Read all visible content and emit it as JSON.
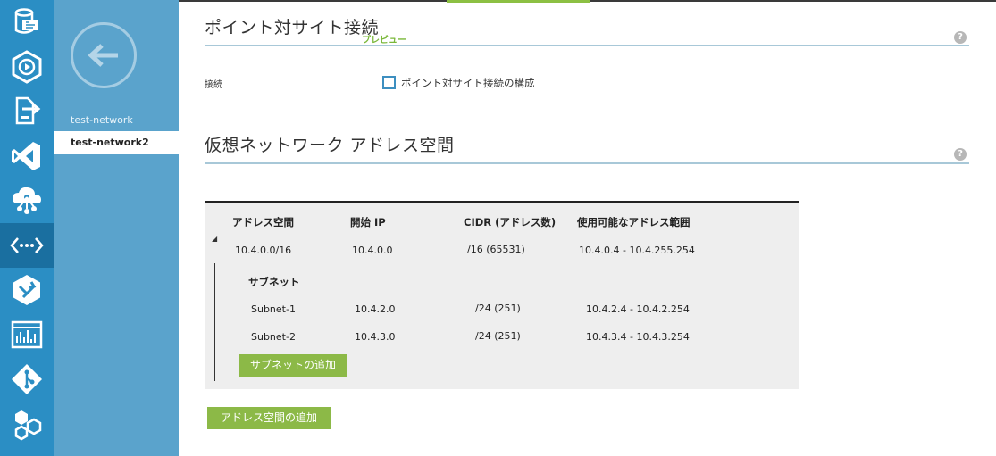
{
  "rail": {
    "icons": [
      "database-icon",
      "media-play-icon",
      "deploy-icon",
      "visual-studio-icon",
      "cloud-services-icon",
      "virtual-network-icon",
      "traffic-manager-icon",
      "dashboard-icon",
      "git-icon",
      "hexagon-apps-icon"
    ],
    "active_index": 5
  },
  "nav": {
    "back_icon": "arrow-left-icon",
    "items": [
      {
        "label": "test-network"
      },
      {
        "label": "test-network2"
      }
    ],
    "active_index": 1
  },
  "p2s": {
    "title": "ポイント対サイト接続",
    "preview": "プレビュー",
    "connection_label": "接続",
    "checkbox_label": "ポイント対サイト接続の構成",
    "checkbox_checked": false
  },
  "vnet": {
    "title": "仮想ネットワーク アドレス空間",
    "help": "?",
    "headers": {
      "space": "アドレス空間",
      "start_ip": "開始 IP",
      "cidr": "CIDR (アドレス数)",
      "range": "使用可能なアドレス範囲"
    },
    "address_space": {
      "space": "10.4.0.0/16",
      "start_ip": "10.4.0.0",
      "cidr": "/16 (65531)",
      "range": "10.4.0.4 - 10.4.255.254"
    },
    "subnet_header": "サブネット",
    "subnets": [
      {
        "name": "Subnet-1",
        "start_ip": "10.4.2.0",
        "cidr": "/24 (251)",
        "range": "10.4.2.4 - 10.4.2.254"
      },
      {
        "name": "Subnet-2",
        "start_ip": "10.4.3.0",
        "cidr": "/24 (251)",
        "range": "10.4.3.4 - 10.4.3.254"
      }
    ],
    "add_subnet_label": "サブネットの追加",
    "add_space_label": "アドレス空間の追加"
  },
  "colors": {
    "rail": "#2b8ec4",
    "rail_active": "#1a6fa0",
    "panel": "#5aa3cc",
    "accent_green": "#8cb947",
    "preview_green": "#7ab83a"
  }
}
